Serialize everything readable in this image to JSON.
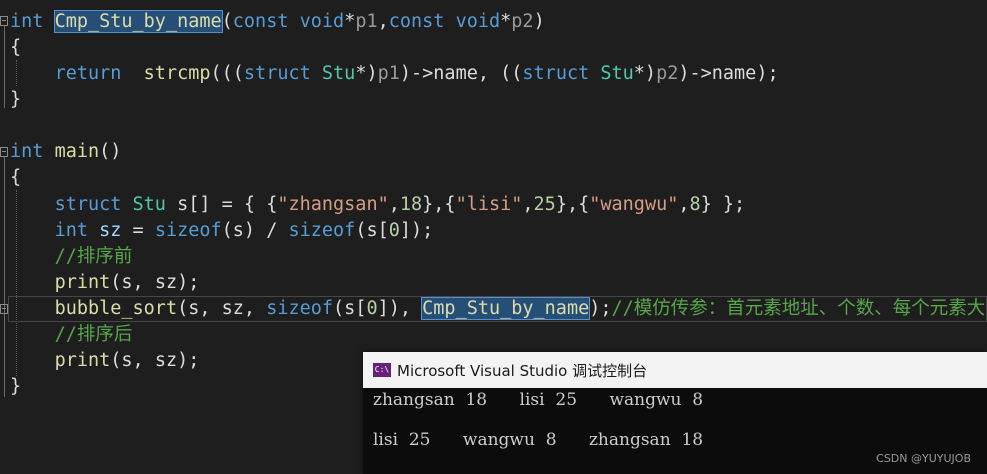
{
  "code": {
    "l1": {
      "kw": "int",
      "fn": "Cmp_Stu_by_name",
      "open": "(",
      "const1": "const",
      "void1": "void",
      "ptr1": "*",
      "p1": "p1",
      "comma": ",",
      "const2": "const",
      "void2": "void",
      "ptr2": "*",
      "p2": "p2",
      "close": ")"
    },
    "l2": {
      "brace": "{"
    },
    "l3": {
      "ret": "return",
      "fn": "strcmp",
      "a": "(((",
      "struct1": "struct",
      "stu1": "Stu",
      "b": "*)",
      "p1": "p1",
      "c": ")->name, ((",
      "struct2": "struct",
      "stu2": "Stu",
      "d": "*)",
      "p2": "p2",
      "e": ")->name);"
    },
    "l4": {
      "brace": "}"
    },
    "l6": {
      "kw": "int",
      "fn": "main",
      "rest": "()"
    },
    "l7": {
      "brace": "{"
    },
    "l8": {
      "struct": "struct",
      "stu": "Stu",
      "a": " s[] = { {",
      "s1": "\"zhangsan\"",
      "b": ",",
      "n1": "18",
      "c": "},{",
      "s2": "\"lisi\"",
      "d": ",",
      "n2": "25",
      "e": "},{",
      "s3": "\"wangwu\"",
      "f": ",",
      "n3": "8",
      "g": "} };"
    },
    "l9": {
      "kw": "int",
      "var": "sz",
      "a": " = ",
      "sz1": "sizeof",
      "b": "(s) / ",
      "sz2": "sizeof",
      "c": "(s[",
      "n": "0",
      "d": "]);"
    },
    "l10": {
      "cmt": "//排序前"
    },
    "l11": {
      "fn": "print",
      "rest": "(s, sz);"
    },
    "l12": {
      "fn": "bubble_sort",
      "a": "(s, sz, ",
      "sz": "sizeof",
      "b": "(s[",
      "n": "0",
      "c": "]), ",
      "arg": "Cmp_Stu_by_name",
      "d": ");",
      "cmt": "//模仿传参：首元素地址、个数、每个元素大"
    },
    "l13": {
      "cmt": "//排序后"
    },
    "l14": {
      "fn": "print",
      "rest": "(s, sz);"
    },
    "l15": {
      "brace": "}"
    }
  },
  "console": {
    "title": "Microsoft Visual Studio 调试控制台",
    "icon_text": "C:\\",
    "line1": "zhangsan  18      lisi  25      wangwu  8",
    "line2": "lisi  25      wangwu  8      zhangsan  18"
  },
  "watermark": "CSDN @YUYUJOB",
  "colors": {
    "background": "#1e1e1e",
    "keyword": "#569cd6",
    "type": "#4ec9b0",
    "function": "#dcdcaa",
    "string": "#d69d85",
    "comment": "#57a64a"
  }
}
